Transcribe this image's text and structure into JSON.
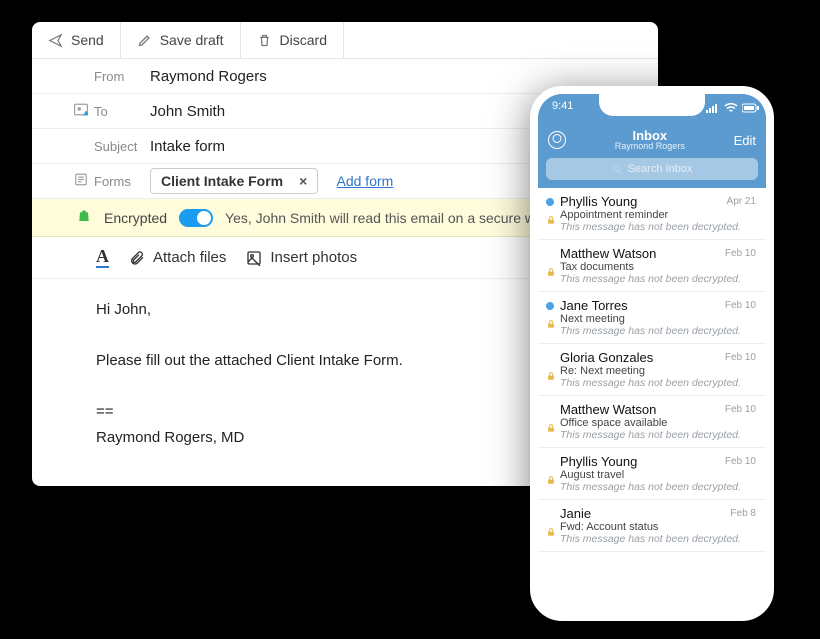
{
  "compose": {
    "toolbar": {
      "send": "Send",
      "save": "Save draft",
      "discard": "Discard"
    },
    "from_label": "From",
    "from_value": "Raymond Rogers",
    "to_label": "To",
    "to_value": "John Smith",
    "subject_label": "Subject",
    "subject_value": "Intake form",
    "forms_label": "Forms",
    "form_tag": "Client Intake Form",
    "form_tag_close": "×",
    "add_form": "Add form",
    "encrypted_label": "Encrypted",
    "encrypted_msg": "Yes, John Smith will read this email on a secure web pa",
    "attach_label": "Attach files",
    "photos_label": "Insert photos",
    "body": "Hi John,\n\nPlease fill out the attached Client Intake Form.\n\n==\nRaymond Rogers, MD"
  },
  "phone": {
    "time": "9:41",
    "nav_title": "Inbox",
    "nav_subtitle": "Raymond Rogers",
    "nav_edit": "Edit",
    "search_placeholder": "Search Inbox",
    "warn_text": "This message has not been decrypted.",
    "messages": [
      {
        "from": "Phyllis Young",
        "date": "Apr 21",
        "subject": "Appointment reminder",
        "unread": true
      },
      {
        "from": "Matthew Watson",
        "date": "Feb 10",
        "subject": "Tax documents",
        "unread": false
      },
      {
        "from": "Jane Torres",
        "date": "Feb 10",
        "subject": "Next meeting",
        "unread": true
      },
      {
        "from": "Gloria Gonzales",
        "date": "Feb 10",
        "subject": "Re: Next meeting",
        "unread": false
      },
      {
        "from": "Matthew Watson",
        "date": "Feb 10",
        "subject": "Office space available",
        "unread": false
      },
      {
        "from": "Phyllis Young",
        "date": "Feb 10",
        "subject": "August travel",
        "unread": false
      },
      {
        "from": "Janie",
        "date": "Feb 8",
        "subject": "Fwd: Account status",
        "unread": false
      }
    ]
  }
}
